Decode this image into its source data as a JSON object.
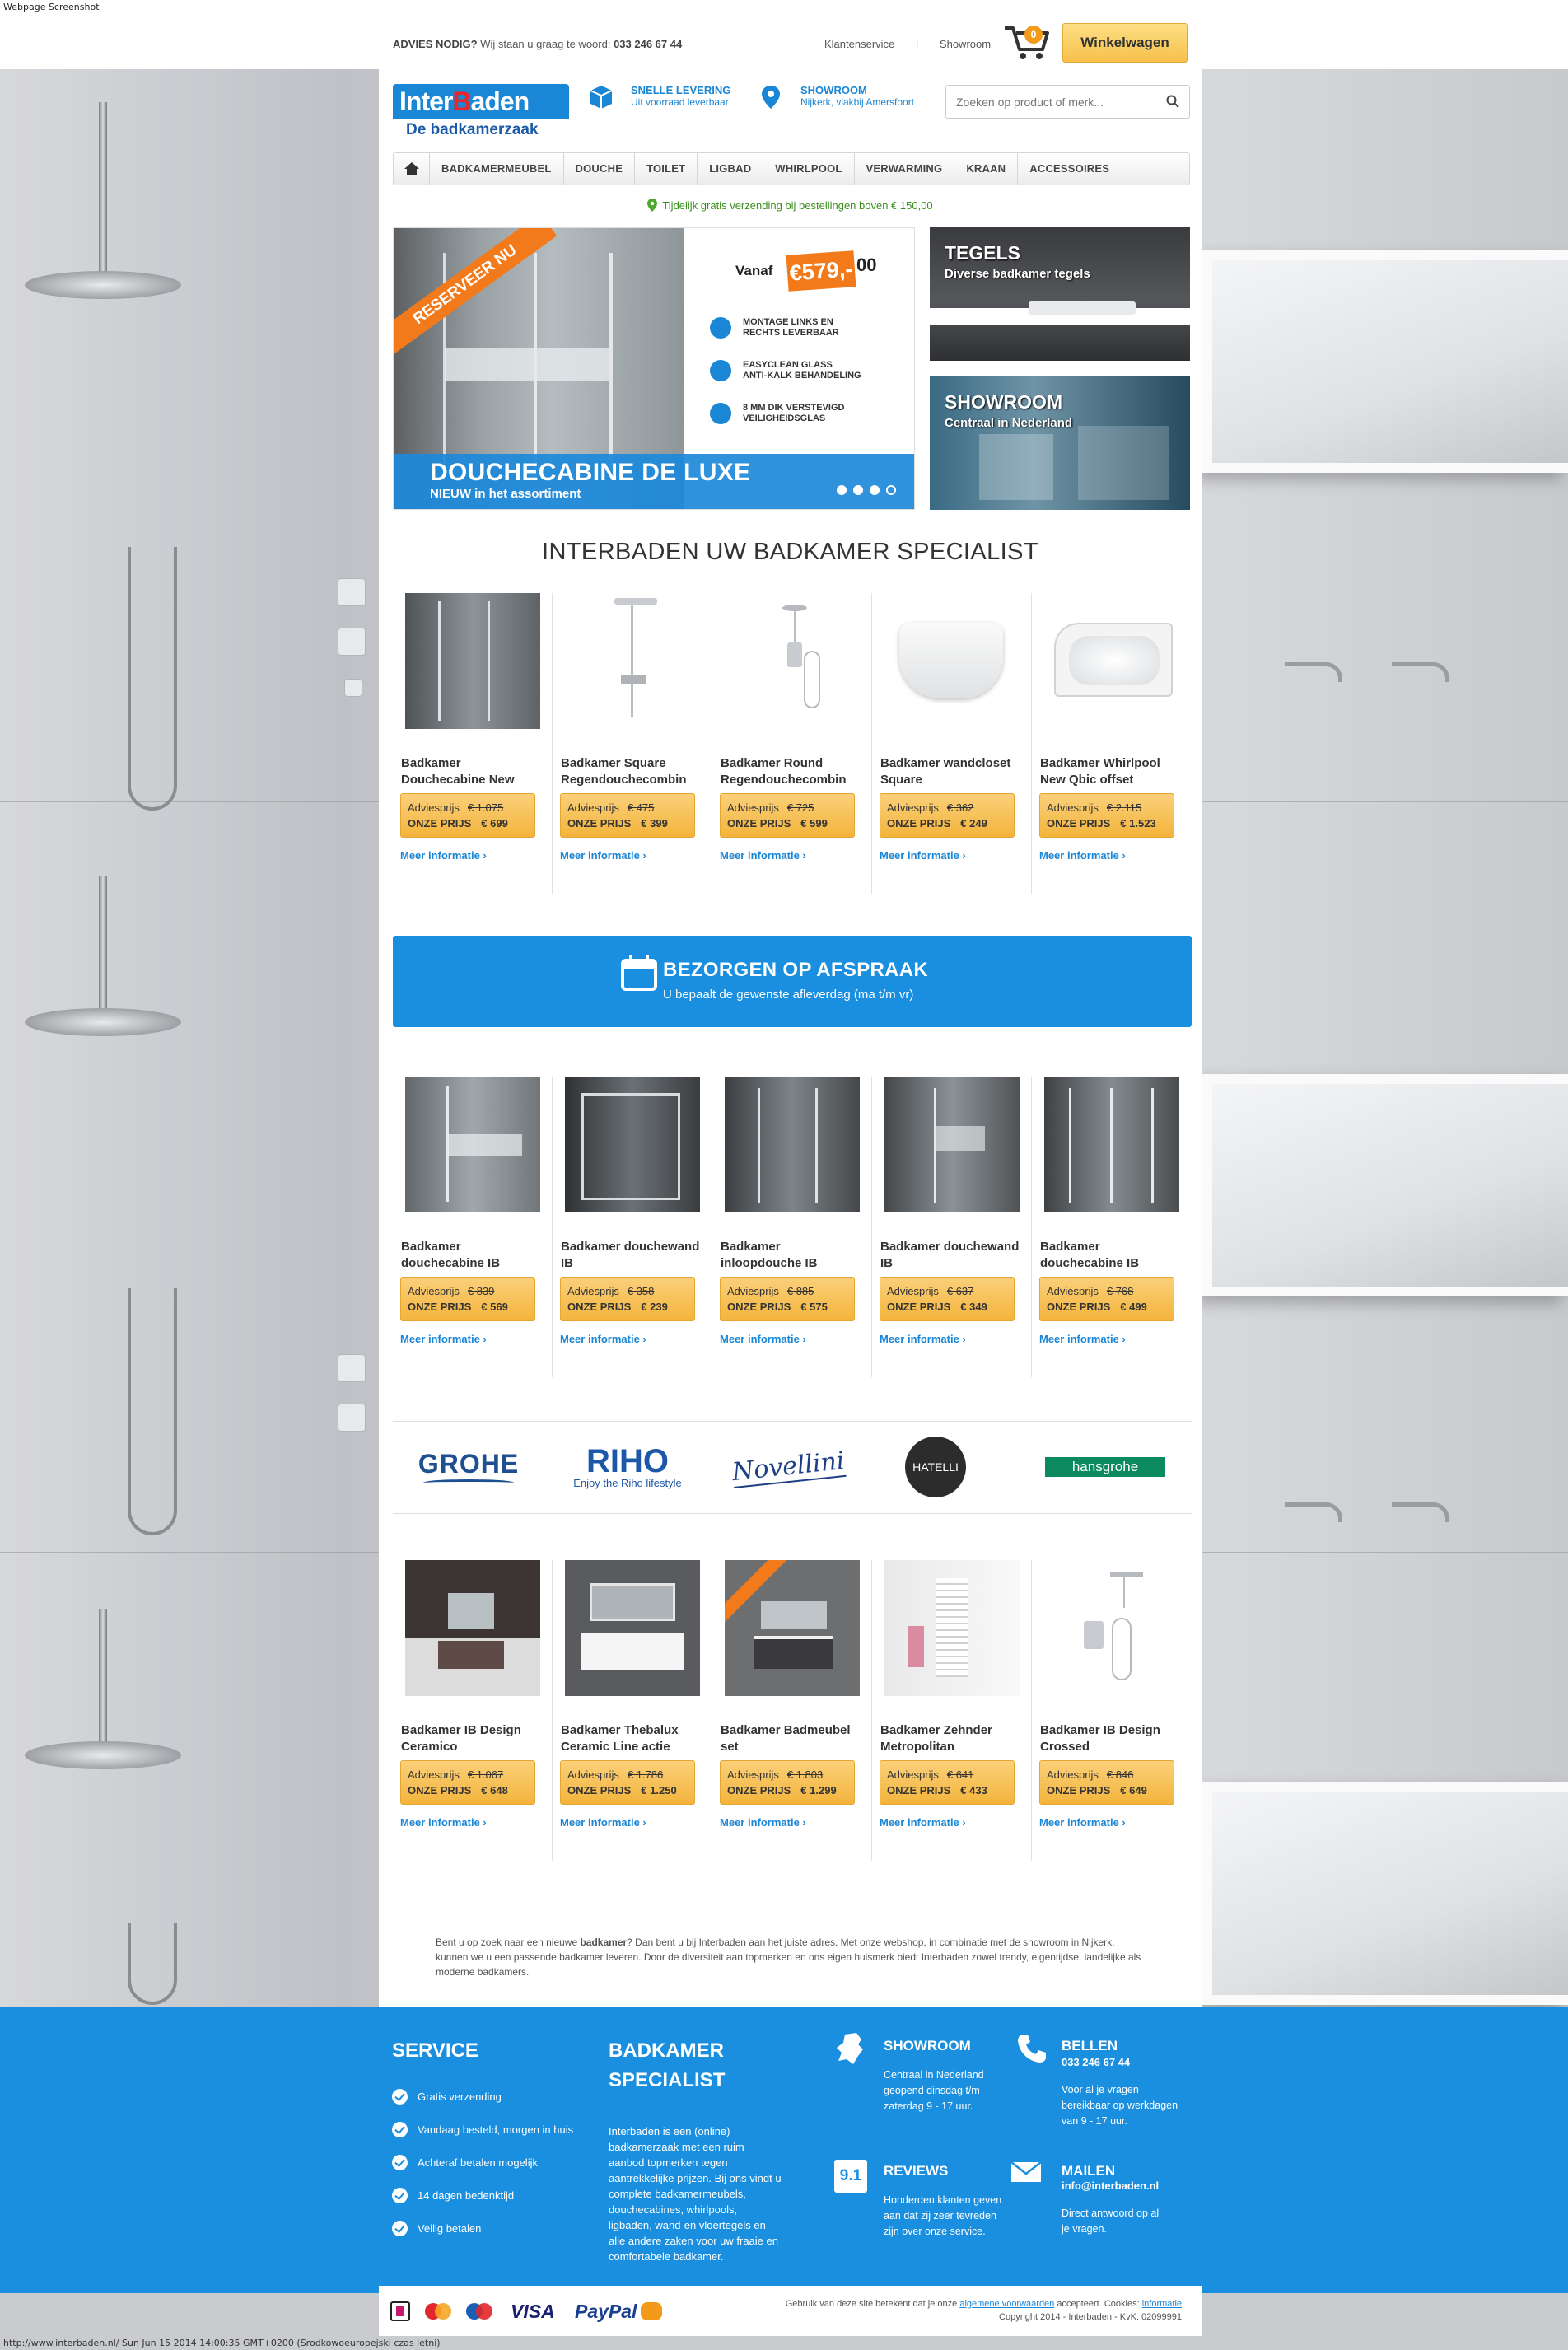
{
  "screenshot": {
    "label": "Webpage Screenshot",
    "status_line": "http://www.interbaden.nl/ Sun Jun 15 2014 14:00:35 GMT+0200 (Środkowoeuropejski czas letni)"
  },
  "colors": {
    "brand_blue": "#1a8fe0",
    "accent_orange": "#f27a1a",
    "price_yellow": "#f7c04a",
    "promo_green": "#3a8f1d"
  },
  "topbar": {
    "advice_bold": "ADVIES NODIG?",
    "advice_text": "Wij staan u graag te woord:",
    "phone": "033 246 67 44",
    "link_service": "Klantenservice",
    "separator": "|",
    "link_showroom": "Showroom",
    "cart_count": "0",
    "cart_button": "Winkelwagen"
  },
  "header": {
    "logo_main_a": "Inter",
    "logo_main_b": "aden",
    "logo_sub": "De badkamerzaak",
    "usp1_title": "SNELLE LEVERING",
    "usp1_sub": "Uit voorraad leverbaar",
    "usp2_title": "SHOWROOM",
    "usp2_sub": "Nijkerk, vlakbij Amersfoort",
    "search_placeholder": "Zoeken op product of merk..."
  },
  "nav": {
    "items": [
      "BADKAMERMEUBEL",
      "DOUCHE",
      "TOILET",
      "LIGBAD",
      "WHIRLPOOL",
      "VERWARMING",
      "KRAAN",
      "ACCESSOIRES"
    ]
  },
  "promo_line": "Tijdelijk gratis verzending bij bestellingen boven € 150,00",
  "hero": {
    "ribbon": "RESERVEER NU",
    "vanaf": "Vanaf",
    "price": "€579,-",
    "old_price": "00",
    "features": [
      "MONTAGE LINKS EN\nRECHTS LEVERBAAR",
      "EASYCLEAN GLASS\nANTI-KALK BEHANDELING",
      "8 MM DIK VERSTEVIGD\nVEILIGHEIDSGLAS"
    ],
    "title": "DOUCHECABINE DE LUXE",
    "subtitle": "NIEUW in het assortiment"
  },
  "side_banners": [
    {
      "title": "TEGELS",
      "subtitle": "Diverse badkamer tegels"
    },
    {
      "title": "SHOWROOM",
      "subtitle": "Centraal in Nederland"
    }
  ],
  "section_title": "INTERBADEN UW BADKAMER SPECIALIST",
  "labels": {
    "adviesprijs": "Adviesprijs",
    "onze_prijs": "ONZE PRIJS",
    "meer_informatie": "Meer informatie ›"
  },
  "products_row1": [
    {
      "name": "Badkamer Douchecabine New",
      "advies": "€ 1.075",
      "prijs": "€ 699"
    },
    {
      "name": "Badkamer Square Regendouchecombin",
      "advies": "€ 475",
      "prijs": "€ 399"
    },
    {
      "name": "Badkamer Round Regendouchecombin",
      "advies": "€ 725",
      "prijs": "€ 599"
    },
    {
      "name": "Badkamer wandcloset Square",
      "advies": "€ 362",
      "prijs": "€ 249"
    },
    {
      "name": "Badkamer Whirlpool New Qbic offset",
      "advies": "€ 2.115",
      "prijs": "€ 1.523"
    }
  ],
  "delivery": {
    "title": "BEZORGEN OP AFSPRAAK",
    "subtitle": "U bepaalt de gewenste afleverdag (ma t/m vr)"
  },
  "products_row2": [
    {
      "name": "Badkamer douchecabine IB",
      "advies": "€ 839",
      "prijs": "€ 569"
    },
    {
      "name": "Badkamer douchewand IB",
      "advies": "€ 358",
      "prijs": "€ 239"
    },
    {
      "name": "Badkamer inloopdouche IB",
      "advies": "€ 885",
      "prijs": "€ 575"
    },
    {
      "name": "Badkamer douchewand IB",
      "advies": "€ 637",
      "prijs": "€ 349"
    },
    {
      "name": "Badkamer douchecabine IB",
      "advies": "€ 768",
      "prijs": "€ 499"
    }
  ],
  "brands": {
    "grohe": "GROHE",
    "riho": "RIHO",
    "riho_tag": "Enjoy the Riho lifestyle",
    "novellini": "Novellini",
    "hatelli": "HATELLI",
    "hansgrohe": "hansgrohe"
  },
  "products_row3": [
    {
      "name": "Badkamer IB Design Ceramico",
      "advies": "€ 1.067",
      "prijs": "€ 648"
    },
    {
      "name": "Badkamer Thebalux Ceramic Line actie",
      "advies": "€ 1.786",
      "prijs": "€ 1.250"
    },
    {
      "name": "Badkamer Badmeubel set",
      "advies": "€ 1.803",
      "prijs": "€ 1.299"
    },
    {
      "name": "Badkamer Zehnder Metropolitan",
      "advies": "€ 641",
      "prijs": "€ 433"
    },
    {
      "name": "Badkamer IB Design Crossed",
      "advies": "€ 846",
      "prijs": "€ 649"
    }
  ],
  "seo": {
    "p1": "Bent u op zoek naar een nieuwe",
    "bold": "badkamer",
    "p2": "? Dan bent u bij Interbaden aan het juiste adres. Met onze webshop, in combinatie met de showroom in Nijkerk, kunnen we u een passende badkamer leveren. Door de diversiteit aan topmerken en ons eigen huismerk biedt Interbaden zowel trendy, eigentijdse, landelijke als moderne badkamers."
  },
  "footer": {
    "service_title": "SERVICE",
    "service_items": [
      "Gratis verzending",
      "Vandaag besteld, morgen in huis",
      "Achteraf betalen mogelijk",
      "14 dagen bedenktijd",
      "Veilig betalen"
    ],
    "specialist_title_1": "BADKAMER",
    "specialist_title_2": "SPECIALIST",
    "specialist_text": "Interbaden is een (online) badkamerzaak met een ruim aanbod topmerken tegen aantrekkelijke prijzen. Bij ons vindt u complete badkamermeubels, douchecabines, whirlpools, ligbaden, wand-en vloertegels en alle andere zaken voor uw fraaie en comfortabele badkamer.",
    "showroom_title": "SHOWROOM",
    "showroom_text": "Centraal in Nederland geopend dinsdag t/m zaterdag 9 - 17 uur.",
    "bellen_title": "BELLEN",
    "bellen_phone": "033 246 67 44",
    "bellen_text": "Voor al je vragen bereikbaar op werkdagen van 9 - 17 uur.",
    "reviews_score": "9.1",
    "reviews_title": "REVIEWS",
    "reviews_text": "Honderden klanten geven aan dat zij zeer tevreden zijn over onze service.",
    "mailen_title": "MAILEN",
    "mailen_email": "info@interbaden.nl",
    "mailen_text": "Direct antwoord op al je vragen."
  },
  "payments": {
    "visa": "VISA",
    "paypal": "PayPal",
    "legal_a": "Gebruik van deze site betekent dat je onze",
    "legal_link": "algemene voorwaarden",
    "legal_b": "accepteert. Cookies:",
    "legal_link2": "informatie",
    "copyright": "Copyright 2014 - Interbaden - KvK: 02099991"
  }
}
